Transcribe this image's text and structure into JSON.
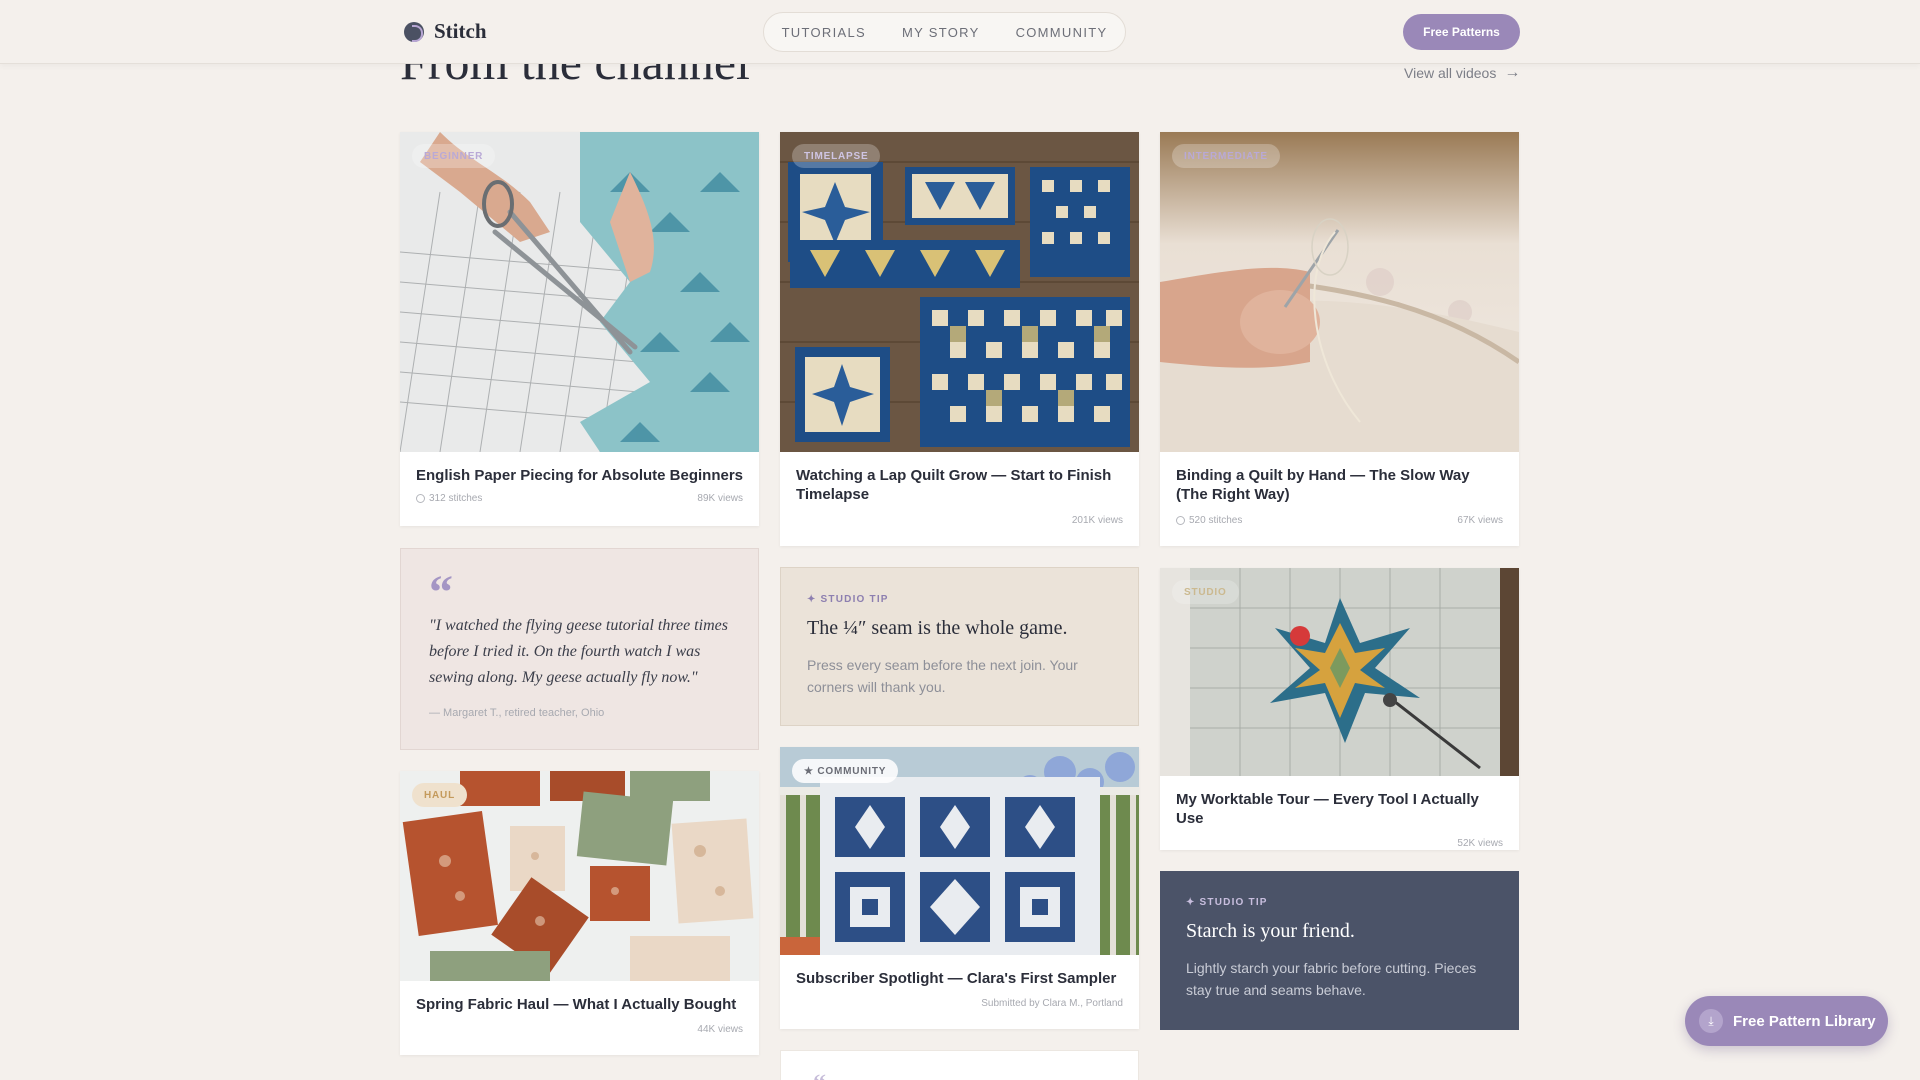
{
  "header": {
    "brand": "Stitch",
    "nav": [
      "TUTORIALS",
      "MY STORY",
      "COMMUNITY"
    ],
    "cta": "Free Patterns"
  },
  "section": {
    "title": "From the channel",
    "view_all": "View all videos"
  },
  "cards": [
    {
      "badge": "BEGINNER",
      "title": "English Paper Piecing for Absolute Beginners",
      "stitches": "312 stitches",
      "views": "89K views"
    },
    {
      "badge": "TIMELAPSE",
      "title": "Watching a Lap Quilt Grow — Start to Finish Timelapse",
      "views": "201K views"
    },
    {
      "badge": "INTERMEDIATE",
      "title": "Binding a Quilt by Hand — The Slow Way (The Right Way)",
      "stitches": "520 stitches",
      "views": "67K views"
    },
    {
      "badge": "STUDIO",
      "title": "My Worktable Tour — Every Tool I Actually Use",
      "views": "52K views"
    },
    {
      "badge": "HAUL",
      "title": "Spring Fabric Haul — What I Actually Bought",
      "views": "44K views"
    },
    {
      "badge": "★ COMMUNITY",
      "title": "Subscriber Spotlight — Clara's First Sampler",
      "submitted": "Submitted by Clara M., Portland"
    }
  ],
  "quote": {
    "mark": "“",
    "text": "\"I watched the flying geese tutorial three times before I tried it. On the fourth watch I was sewing along. My geese actually fly now.\"",
    "by": "— Margaret T., retired teacher, Ohio"
  },
  "tips": [
    {
      "label": "✦ STUDIO TIP",
      "title": "The ¼″ seam is the whole game.",
      "text": "Press every seam before the next join. Your corners will thank you."
    },
    {
      "label": "✦ STUDIO TIP",
      "title": "Starch is your friend.",
      "text": "Lightly starch your fabric before cutting. Pieces stay true and seams behave."
    }
  ],
  "floating_cta": "Free Pattern Library",
  "colors": {
    "accent": "#9a88b8",
    "dark_tip": "#4b5368",
    "background": "#f4f0ec"
  }
}
